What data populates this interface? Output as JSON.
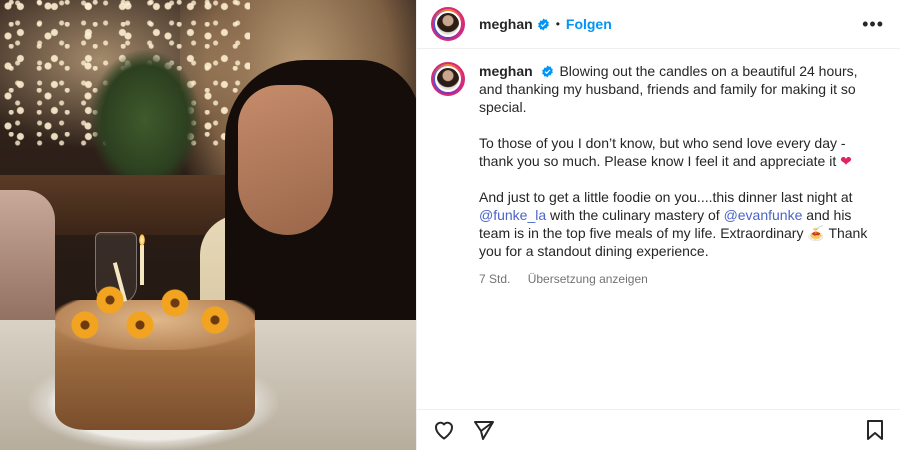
{
  "header": {
    "username": "meghan",
    "separator": "•",
    "follow_label": "Folgen",
    "more_label": "•••"
  },
  "caption": {
    "username": "meghan",
    "paragraph1": "Blowing out the candles on a beautiful 24 hours, and thanking my husband, friends and family for making it so special.",
    "paragraph2": "To those of you I don’t know, but who send love every day - thank you so much. Please know I feel it and appreciate it",
    "paragraph2_emoji": "❤",
    "paragraph3_pre": "And just to get a little foodie on you....this dinner last night at",
    "mention1": "@funke_la",
    "paragraph3_mid": "with the culinary mastery of",
    "mention2": "@evanfunke",
    "paragraph3_post": "and his team is in the top five meals of my life. Extraordinary",
    "paragraph3_emoji": "🍝",
    "paragraph3_end": "Thank you for a standout dining experience.",
    "time": "7 Std.",
    "translate_label": "Übersetzung anzeigen"
  },
  "colors": {
    "follow": "#0095f6",
    "mention": "#4a65c6",
    "verified": "#0095f6",
    "heart": "#e0245e"
  },
  "icons": [
    "verified-badge-icon",
    "more-icon",
    "heart-icon",
    "share-icon",
    "bookmark-icon"
  ]
}
